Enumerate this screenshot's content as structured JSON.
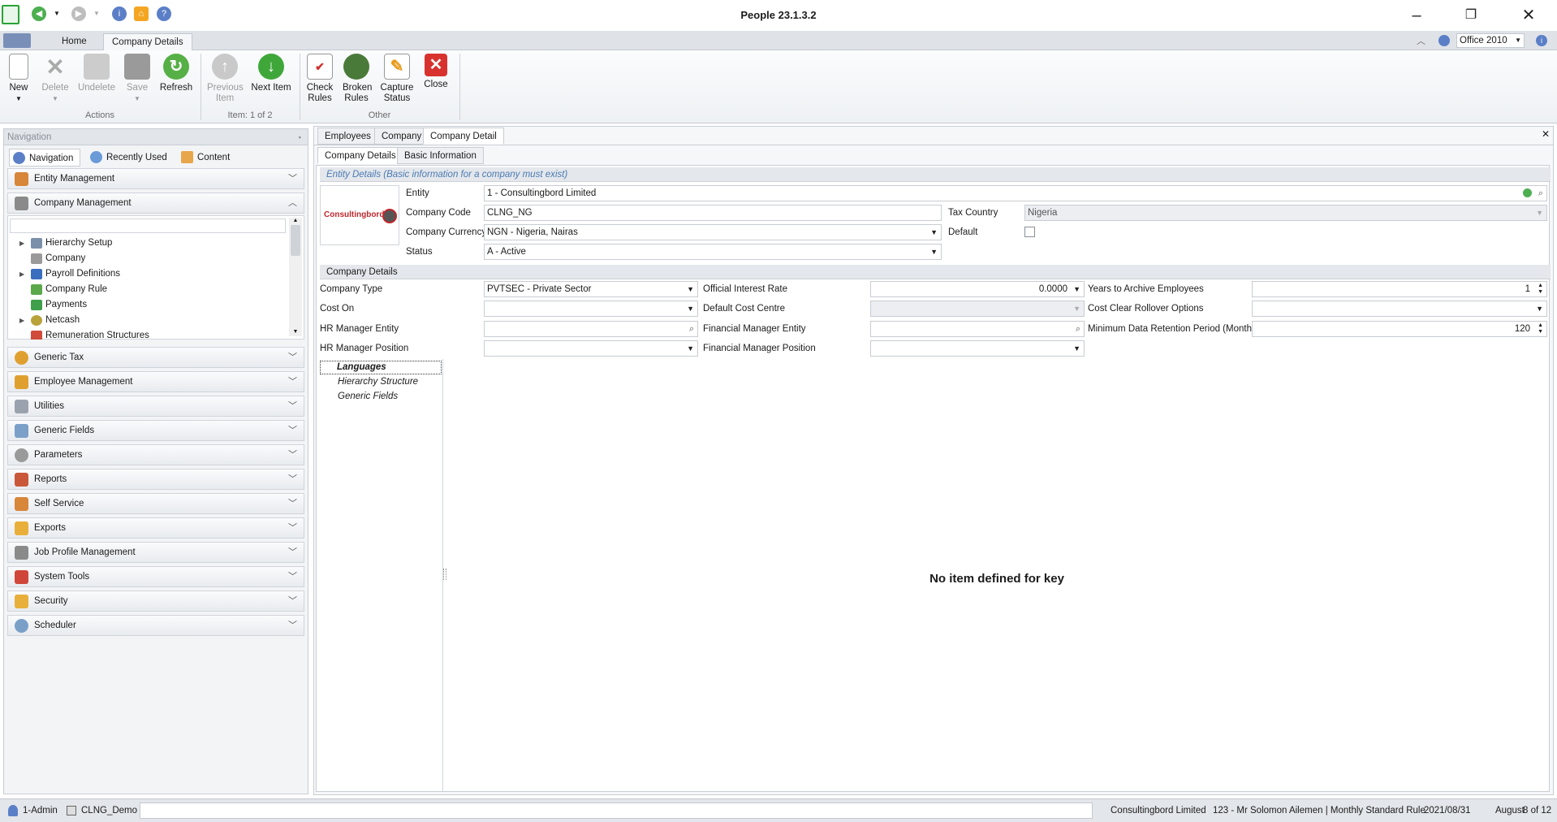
{
  "window": {
    "title": "People 23.1.3.2"
  },
  "ribbon_tabs": {
    "home": "Home",
    "company_details": "Company Details"
  },
  "theme": "Office 2010",
  "ribbon": {
    "new": "New",
    "delete": "Delete",
    "undelete": "Undelete",
    "save": "Save",
    "refresh": "Refresh",
    "previous": "Previous Item",
    "next": "Next Item",
    "check_rules": "Check Rules",
    "broken_rules": "Broken Rules",
    "capture_status": "Capture Status",
    "close": "Close",
    "group_actions": "Actions",
    "group_item": "Item: 1 of 2",
    "group_other": "Other"
  },
  "navigation": {
    "header": "Navigation",
    "tabs": {
      "navigation": "Navigation",
      "recently_used": "Recently Used",
      "content": "Content"
    },
    "entity_management": "Entity Management",
    "company_management": "Company Management",
    "tree": [
      "Hierarchy Setup",
      "Company",
      "Payroll Definitions",
      "Company Rule",
      "Payments",
      "Netcash",
      "Remuneration Structures"
    ],
    "groups": [
      "Generic Tax",
      "Employee Management",
      "Utilities",
      "Generic Fields",
      "Parameters",
      "Reports",
      "Self Service",
      "Exports",
      "Job Profile Management",
      "System Tools",
      "Security",
      "Scheduler"
    ]
  },
  "doc_tabs": {
    "employees": "Employees",
    "company": "Company",
    "company_detail": "Company Detail"
  },
  "sub_tabs": {
    "company_details": "Company Details",
    "basic_information": "Basic Information"
  },
  "entity_section": {
    "title": "Entity Details (Basic information for a company must exist)",
    "logo": "Consultingbord",
    "entity_label": "Entity",
    "entity_value": "1 - Consultingbord Limited",
    "company_code_label": "Company Code",
    "company_code_value": "CLNG_NG",
    "currency_label": "Company Currency",
    "currency_value": "NGN - Nigeria, Nairas",
    "status_label": "Status",
    "status_value": "A - Active",
    "tax_country_label": "Tax Country",
    "tax_country_value": "Nigeria",
    "default_label": "Default"
  },
  "company_section": {
    "title": "Company Details",
    "company_type_label": "Company Type",
    "company_type_value": "PVTSEC - Private Sector",
    "cost_on_label": "Cost On",
    "hr_entity_label": "HR Manager Entity",
    "hr_position_label": "HR Manager Position",
    "interest_label": "Official Interest Rate",
    "interest_value": "0.0000",
    "cost_centre_label": "Default Cost Centre",
    "fin_entity_label": "Financial Manager Entity",
    "fin_position_label": "Financial Manager Position",
    "archive_label": "Years to Archive Employees",
    "archive_value": "1",
    "rollover_label": "Cost Clear Rollover Options",
    "retention_label": "Minimum Data Retention Period (Months):",
    "retention_value": "120"
  },
  "side_list": [
    "Languages",
    "Hierarchy Structure",
    "Generic Fields"
  ],
  "empty_message": "No item defined for key",
  "status_bar": {
    "user": "1-Admin",
    "db": "CLNG_Demo",
    "company": "Consultingbord Limited",
    "employee": "123 - Mr Solomon Ailemen | Monthly Standard Rule",
    "date": "2021/08/31",
    "month": "August",
    "page": "8 of 12"
  }
}
